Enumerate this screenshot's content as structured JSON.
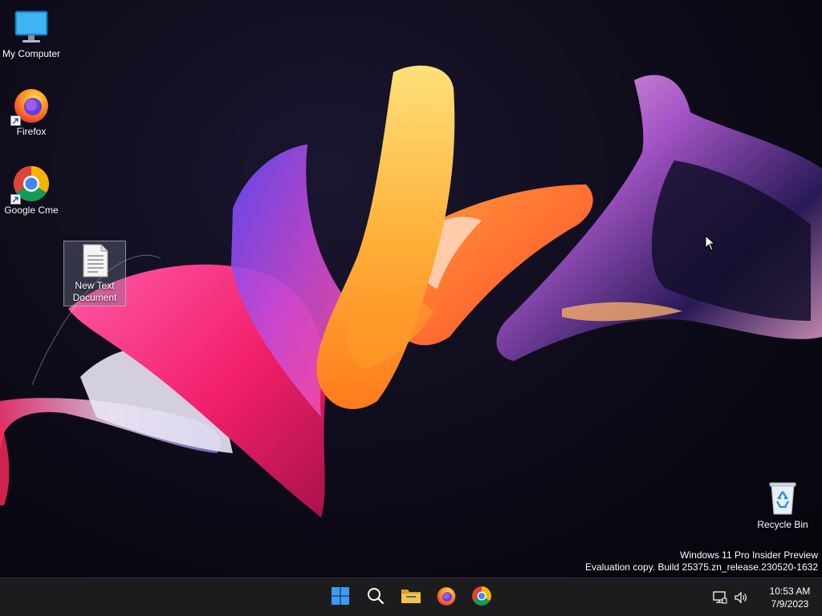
{
  "desktop": {
    "icons": [
      {
        "label": "My Computer",
        "icon": "monitor-icon"
      },
      {
        "label": "Firefox",
        "icon": "firefox-icon"
      },
      {
        "label": "Google Cme",
        "icon": "chrome-icon"
      },
      {
        "label": "New Text Document",
        "label_line1": "New Text",
        "label_line2": "Document",
        "icon": "text-document-icon"
      },
      {
        "label": "Recycle Bin",
        "icon": "recycle-bin-icon"
      }
    ],
    "watermark": {
      "line1": "Windows 11 Pro Insider Preview",
      "line2": "Evaluation copy. Build 25375.zn_release.230520-1632"
    }
  },
  "taskbar": {
    "apps": [
      {
        "name": "start",
        "icon": "windows-start-icon"
      },
      {
        "name": "search",
        "icon": "search-icon"
      },
      {
        "name": "file-explorer",
        "icon": "folder-icon"
      },
      {
        "name": "firefox",
        "icon": "firefox-icon"
      },
      {
        "name": "chrome",
        "icon": "chrome-icon"
      }
    ],
    "tray": {
      "icons": [
        "network-icon",
        "speaker-icon"
      ],
      "time": "10:53 AM",
      "date": "7/9/2023"
    }
  },
  "colors": {
    "taskbar_bg": "#1c1c1f",
    "start_blue": "#3a9bf0",
    "folder_yellow": "#f5c542",
    "desktop_bg": "#0d0b18"
  }
}
